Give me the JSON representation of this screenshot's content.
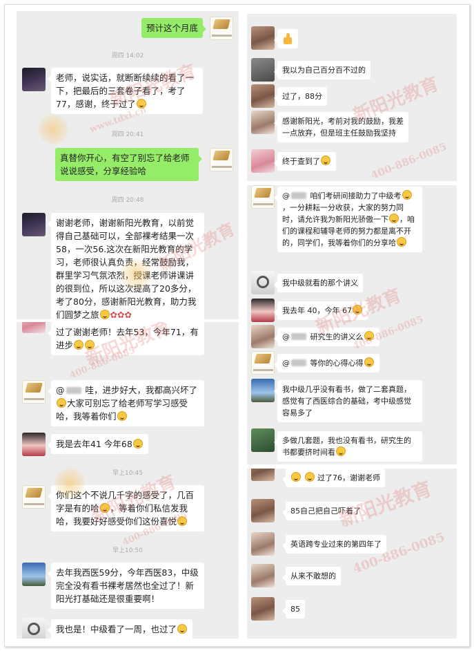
{
  "watermark": {
    "brand": "新阳光教育",
    "site": "www.tdxl.cn",
    "phone": "400-886-0085",
    "color": "#e0786e"
  },
  "panel1": {
    "msg1": "预计这个月底",
    "time1": "周四 14:02",
    "msg2": "老师，说实话，就断断续续的看了一下，把最后的三套卷子看了，考了77，感谢，终于过了",
    "time2": "周四 20:41",
    "msg3": "真替你开心，有空了别忘了给老师说说感受，分享经验哈",
    "time3": "周四 20:48",
    "msg4": "谢谢老师，谢谢新阳光教育，以前觉得自己基础可以，全部裸考结果一次58，一次56.这次在新阳光教育的学习，老师很认真负责，经常鼓励我，群里学习气氛浓烈，授课老师讲课讲的很到位，所以这次提高了20多分，考了80分，感谢新阳光教育，助力我们圆梦之旅"
  },
  "panel2": {
    "msg1": "过了谢谢老师！去年53，今年71，有进步",
    "msg2a": "@",
    "msg2b": " 哇，进步好大，我都高兴坏了",
    "msg2c": "大家可别忘了给老师写学习感受哈，我等着你们",
    "msg3": "我是去年41 今年68",
    "time1": "早上10:45",
    "msg4": "你们这个不说几千字的感受了，几百字是有的哈",
    "msg4b": "，等着你们私信发我哈，我要好好感受你们这份喜悦",
    "time2": "早上10:50",
    "msg5": "去年我西医59分，今年西医83，中级完全没有看书裸考居然也全过了！新阳光打基础还是很重要啊！",
    "msg6": "我也是！中级看了一周，也过了"
  },
  "panel3": {
    "msg2": "我以为自己百分百不过的",
    "msg3": "过了，88分",
    "msg4": "感谢新阳光，考前对我的鼓励，我差一点放弃，但是班主任鼓励我坚持",
    "msg5": "终于查到了"
  },
  "panel4": {
    "msg1a": "@",
    "msg1b": " 咱们考研间接助力了中级考",
    "msg1c": "，一分耕耘一分收获，大家的努力同时，请允许我为新阳光骄傲一下",
    "msg1d": "，咱们的课程和辅导老师的努力都是离不开的，同学们，我等着你们的分享哈",
    "msg2": "我中级就看的那个讲义",
    "msg3": "我去年 40，今年 67",
    "msg4a": "@",
    "msg4b": " 研究生的讲义么",
    "msg5a": "@",
    "msg5b": " 等你的心得心得",
    "msg6": "我中级几乎没有看书，做了二套真题，感觉有了西医综合的基础，考中级感觉容易多了",
    "msg7": "多做几套题，我也没有看书，研究生的书都要挤时间看"
  },
  "panel5": {
    "msg1": "过了76，谢谢老师",
    "msg2": "85自己把自己吓着了",
    "msg3": "英语跨专业过来的第四年了",
    "msg4": "从来不敢想的",
    "msg5": "85"
  }
}
